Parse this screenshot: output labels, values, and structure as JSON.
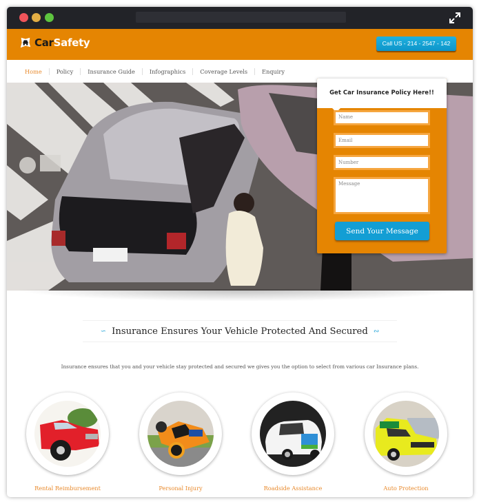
{
  "window": {
    "title_bar_buttons": [
      "close",
      "minimize",
      "maximize"
    ],
    "expand_icon": "expand-arrows-icon"
  },
  "header": {
    "logo_icon": "car-badge-icon",
    "logo_part1": "Car",
    "logo_part2": "Safety",
    "call_button": "Call US - 214 - 2547 - 142",
    "brand_color": "#e58502",
    "accent_color": "#139ed4"
  },
  "nav": {
    "items": [
      {
        "label": "Home",
        "active": true
      },
      {
        "label": "Policy",
        "active": false
      },
      {
        "label": "Insurance Guide",
        "active": false
      },
      {
        "label": "Infographics",
        "active": false
      },
      {
        "label": "Coverage Levels",
        "active": false
      },
      {
        "label": "Enquiry",
        "active": false
      }
    ]
  },
  "hero": {
    "image": "car-accident-photo",
    "form": {
      "title": "Get Car Insurance Policy Here!!",
      "name_placeholder": "Name",
      "email_placeholder": "Email",
      "number_placeholder": "Number",
      "message_placeholder": "Message",
      "submit_label": "Send Your Message"
    }
  },
  "section": {
    "title": "Insurance Ensures Your Vehicle Protected And Secured",
    "swirl_left": "∽",
    "swirl_right": "∾",
    "description": "Insurance ensures that you and your vehicle stay protected and secured we gives you the option to select from various car Insurance plans."
  },
  "features": [
    {
      "label": "Rental Reimbursement",
      "image": "red-pickup-truck-photo"
    },
    {
      "label": "Personal Injury",
      "image": "motorcycle-racer-photo"
    },
    {
      "label": "Roadside Assistance",
      "image": "white-compact-car-photo"
    },
    {
      "label": "Auto Protection",
      "image": "yellow-ambulance-photo"
    }
  ]
}
